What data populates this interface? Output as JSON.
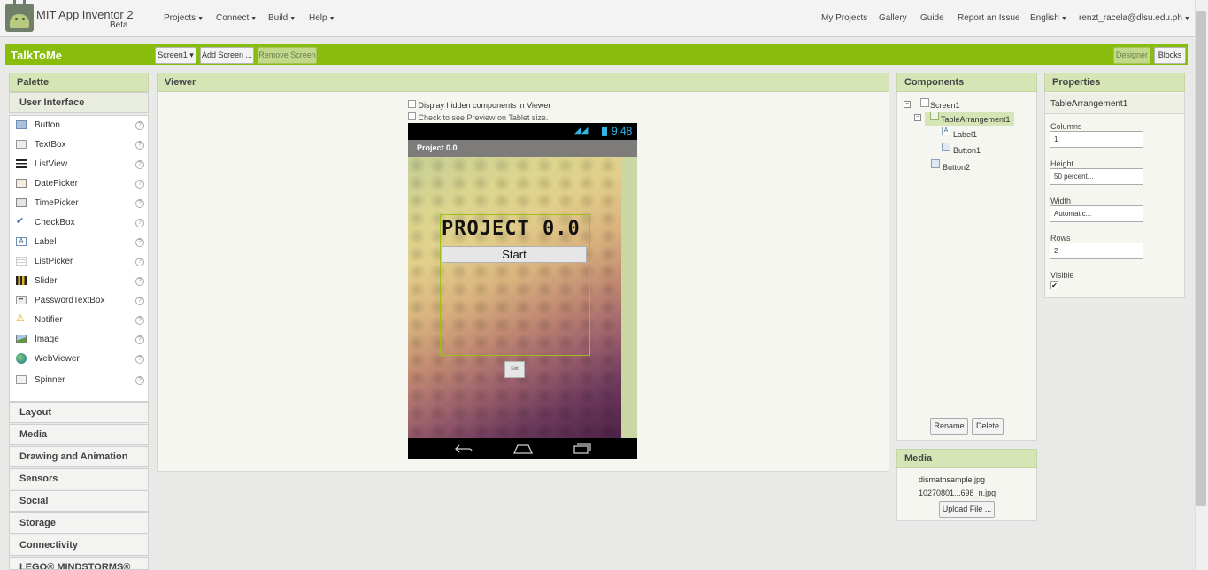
{
  "app": {
    "name": "MIT App Inventor 2",
    "beta": "Beta"
  },
  "menus": {
    "left": [
      "Projects",
      "Connect",
      "Build",
      "Help"
    ],
    "right": [
      "My Projects",
      "Gallery",
      "Guide",
      "Report an Issue",
      "English",
      "renzt_racela@dlsu.edu.ph"
    ]
  },
  "project": {
    "name": "TalkToMe",
    "screen_select": "Screen1 ▾",
    "add_screen": "Add Screen ...",
    "remove_screen": "Remove Screen",
    "designer": "Designer",
    "blocks": "Blocks"
  },
  "palette": {
    "title": "Palette",
    "active_category": "User Interface",
    "items": [
      {
        "label": "Button",
        "icon": "button-icon"
      },
      {
        "label": "TextBox",
        "icon": "textbox-icon"
      },
      {
        "label": "ListView",
        "icon": "listview-icon"
      },
      {
        "label": "DatePicker",
        "icon": "datepicker-icon"
      },
      {
        "label": "TimePicker",
        "icon": "timepicker-icon"
      },
      {
        "label": "CheckBox",
        "icon": "checkbox-icon"
      },
      {
        "label": "Label",
        "icon": "label-icon"
      },
      {
        "label": "ListPicker",
        "icon": "listpicker-icon"
      },
      {
        "label": "Slider",
        "icon": "slider-icon"
      },
      {
        "label": "PasswordTextBox",
        "icon": "passwordtextbox-icon"
      },
      {
        "label": "Notifier",
        "icon": "notifier-icon"
      },
      {
        "label": "Image",
        "icon": "image-icon"
      },
      {
        "label": "WebViewer",
        "icon": "webviewer-icon"
      },
      {
        "label": "Spinner",
        "icon": "spinner-icon"
      }
    ],
    "help": "?",
    "categories": [
      "Layout",
      "Media",
      "Drawing and Animation",
      "Sensors",
      "Social",
      "Storage",
      "Connectivity",
      "LEGO® MINDSTORMS®"
    ]
  },
  "viewer": {
    "title": "Viewer",
    "hidden_label": "Display hidden components in Viewer",
    "tablet_label": "Check to see Preview on Tablet size.",
    "phone": {
      "time": "9:48",
      "title": "Project 0.0",
      "label1_text": "PROJECT 0.0",
      "button1_text": "Start",
      "button2_text": "Exit"
    }
  },
  "components": {
    "title": "Components",
    "tree": {
      "screen": "Screen1",
      "arrangement": "TableArrangement1",
      "label": "Label1",
      "button1": "Button1",
      "button2": "Button2"
    },
    "rename": "Rename",
    "delete": "Delete"
  },
  "media": {
    "title": "Media",
    "files": [
      "dismathsample.jpg",
      "10270801...698_n.jpg"
    ],
    "upload": "Upload File ..."
  },
  "properties": {
    "title": "Properties",
    "selected": "TableArrangement1",
    "fields": [
      {
        "label": "Columns",
        "value": "1"
      },
      {
        "label": "Height",
        "value": "50 percent..."
      },
      {
        "label": "Width",
        "value": "Automatic..."
      },
      {
        "label": "Rows",
        "value": "2"
      }
    ],
    "visible_label": "Visible",
    "visible_checked": true
  },
  "colors": {
    "accent_green": "#89bd0d",
    "panel_header": "#d5e5b6"
  }
}
